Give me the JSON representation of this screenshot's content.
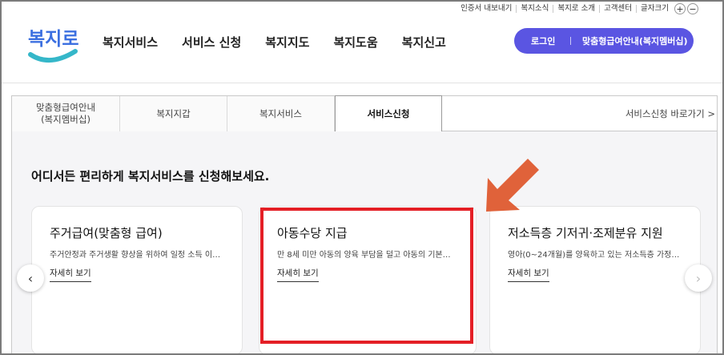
{
  "utility": {
    "items": [
      "인증서 내보내기",
      "복지소식",
      "복지로 소개",
      "고객센터"
    ],
    "font_size_label": "글자크기",
    "zoom_in": "+",
    "zoom_out": "−"
  },
  "logo": {
    "text": "복지로"
  },
  "gnb": {
    "items": [
      "복지서비스",
      "서비스 신청",
      "복지지도",
      "복지도움",
      "복지신고"
    ]
  },
  "header_button": {
    "login": "로그인",
    "customized": "맞춤형급여안내(복지멤버십)"
  },
  "tabs": {
    "items": [
      {
        "line1": "맞춤형급여안내",
        "line2": "(복지멤버십)"
      },
      {
        "line1": "복지지갑",
        "line2": ""
      },
      {
        "line1": "복지서비스",
        "line2": ""
      },
      {
        "line1": "서비스신청",
        "line2": ""
      }
    ],
    "active_index": 3,
    "shortcut": "서비스신청 바로가기 >"
  },
  "headline": "어디서든 편리하게 복지서비스를 신청해보세요.",
  "cards": [
    {
      "title": "주거급여(맞춤형 급여)",
      "desc": "주거안정과 주거생활 향상을 위하여 일정 소득 이…",
      "more": "자세히 보기"
    },
    {
      "title": "아동수당 지급",
      "desc": "만 8세 미만 아동의 양육 부담을 덜고 아동의 기본…",
      "more": "자세히 보기"
    },
    {
      "title": "저소득층 기저귀·조제분유 지원",
      "desc": "영아(0~24개월)를 양육하고 있는 저소득층 가정…",
      "more": "자세히 보기"
    }
  ],
  "carousel": {
    "prev": "‹",
    "next": "›"
  },
  "colors": {
    "brand_purple": "#5a55e2",
    "highlight_red": "#e41f26",
    "annotation_arrow": "#e0623a",
    "logo_blue": "#3b6fe0",
    "logo_teal": "#35b7c9"
  }
}
